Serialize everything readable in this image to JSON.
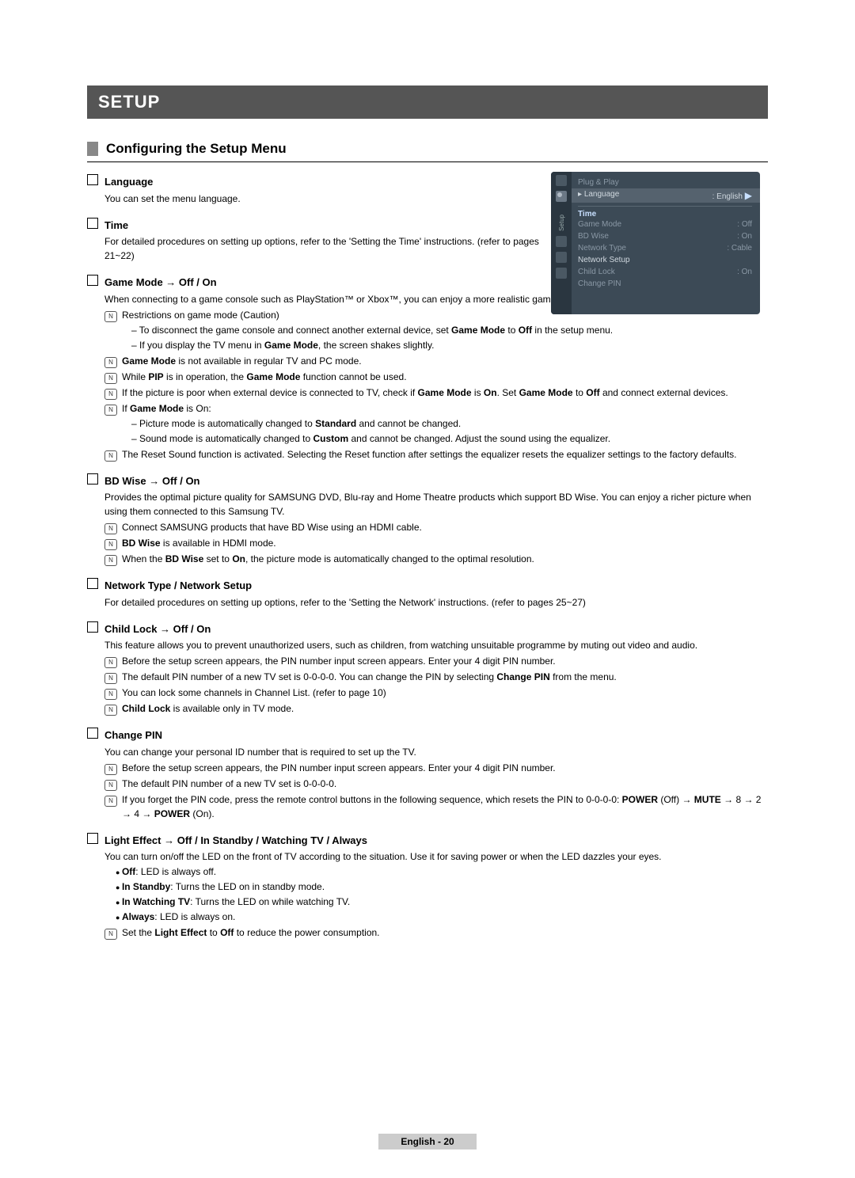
{
  "title_bar": "SETUP",
  "section_title": "Configuring the Setup Menu",
  "osd": {
    "side_label": "Setup",
    "plug_play": "Plug & Play",
    "lang_label": "Language",
    "lang_value": ": English",
    "time_header": "Time",
    "game_mode_label": "Game Mode",
    "game_mode_value": ": Off",
    "bd_wise_label": "BD Wise",
    "bd_wise_value": ": On",
    "net_type_label": "Network Type",
    "net_type_value": ": Cable",
    "net_setup_label": "Network Setup",
    "child_lock_label": "Child Lock",
    "child_lock_value": ": On",
    "change_pin_label": "Change PIN"
  },
  "items": {
    "language": {
      "title": "Language",
      "desc": "You can set the menu language."
    },
    "time": {
      "title": "Time",
      "desc": "For detailed procedures on setting up options, refer to the 'Setting the Time' instructions. (refer to pages 21~22)"
    },
    "game_mode": {
      "title": "Game Mode → Off / On",
      "desc": "When connecting to a game console such as PlayStation™ or Xbox™, you can enjoy a more realistic gaming experience by selecting game menu.",
      "note1": "Restrictions on game mode (Caution)",
      "dash1_pre": "To disconnect the game console and connect another external device, set ",
      "dash1_b1": "Game Mode",
      "dash1_mid": " to ",
      "dash1_b2": "Off",
      "dash1_post": " in the setup menu.",
      "dash2_pre": "If you display the TV menu in ",
      "dash2_b": "Game Mode",
      "dash2_post": ", the screen shakes slightly.",
      "note2_b": "Game Mode",
      "note2_post": " is not available in regular TV and PC mode.",
      "note3_pre": "While ",
      "note3_b1": "PIP",
      "note3_mid": " is in operation, the ",
      "note3_b2": "Game Mode",
      "note3_post": " function cannot be used.",
      "note4_pre": "If the picture is poor when external device is connected to TV, check if ",
      "note4_b1": "Game Mode",
      "note4_mid1": " is ",
      "note4_b2": "On",
      "note4_mid2": ". Set ",
      "note4_b3": "Game Mode",
      "note4_mid3": " to ",
      "note4_b4": "Off",
      "note4_post": " and connect external devices.",
      "note5_pre": "If ",
      "note5_b": "Game Mode",
      "note5_post": " is On:",
      "dash3_pre": "Picture mode is automatically changed to ",
      "dash3_b": "Standard",
      "dash3_post": " and cannot be changed.",
      "dash4_pre": "Sound mode is automatically changed to ",
      "dash4_b": "Custom",
      "dash4_post": " and cannot be changed. Adjust the sound using the equalizer.",
      "note6": "The Reset Sound function is activated. Selecting the Reset function after settings the equalizer resets the equalizer settings to the factory defaults."
    },
    "bd_wise": {
      "title": "BD Wise → Off / On",
      "desc": "Provides the optimal picture quality for SAMSUNG DVD, Blu-ray and Home Theatre products which support BD Wise. You can enjoy a richer picture when using them connected to this Samsung TV.",
      "note1": "Connect SAMSUNG products that have BD Wise using an HDMI cable.",
      "note2_b": "BD Wise",
      "note2_post": " is available in HDMI mode.",
      "note3_pre": "When the ",
      "note3_b1": "BD Wise",
      "note3_mid": " set to ",
      "note3_b2": "On",
      "note3_post": ", the picture mode is automatically changed to the optimal resolution."
    },
    "network": {
      "title": "Network Type / Network Setup",
      "desc": "For detailed procedures on setting up options, refer to the 'Setting the Network' instructions. (refer to pages 25~27)"
    },
    "child_lock": {
      "title": "Child Lock → Off / On",
      "desc": "This feature allows you to prevent unauthorized users, such as children, from watching unsuitable programme by muting out video and audio.",
      "note1": "Before the setup screen appears, the PIN number input screen appears. Enter your 4 digit PIN number.",
      "note2_pre": "The default PIN number of a new TV set is 0-0-0-0. You can change the PIN by selecting ",
      "note2_b": "Change PIN",
      "note2_post": " from the menu.",
      "note3": "You can lock some channels in Channel List. (refer to page 10)",
      "note4_b": "Child Lock",
      "note4_post": " is available only in TV mode."
    },
    "change_pin": {
      "title": "Change PIN",
      "desc": "You can change your personal ID number that is required to set up the TV.",
      "note1": "Before the setup screen appears, the PIN number input screen appears. Enter your 4 digit PIN number.",
      "note2": "The default PIN number of a new TV set is 0-0-0-0.",
      "note3_pre": "If you forget the PIN code, press the remote control buttons in the following sequence, which resets the PIN to 0-0-0-0: ",
      "note3_b1": "POWER",
      "note3_mid1": " (Off) → ",
      "note3_b2": "MUTE",
      "note3_mid2": " → 8 → 2 → 4 → ",
      "note3_b3": "POWER",
      "note3_post": " (On)."
    },
    "light_effect": {
      "title": "Light Effect → Off / In Standby / Watching TV / Always",
      "desc": "You can turn on/off the LED on the front of TV according to the situation. Use it for saving power or when the LED dazzles your eyes.",
      "b1_b": "Off",
      "b1_post": ": LED is always off.",
      "b2_b": "In Standby",
      "b2_post": ": Turns the LED on in standby mode.",
      "b3_b": "In Watching TV",
      "b3_post": ": Turns the LED on while watching TV.",
      "b4_b": "Always",
      "b4_post": ": LED is always on.",
      "note1_pre": "Set the ",
      "note1_b1": "Light Effect",
      "note1_mid": " to ",
      "note1_b2": "Off",
      "note1_post": " to reduce the power consumption."
    }
  },
  "footer": {
    "lang": "English",
    "page": "20"
  }
}
